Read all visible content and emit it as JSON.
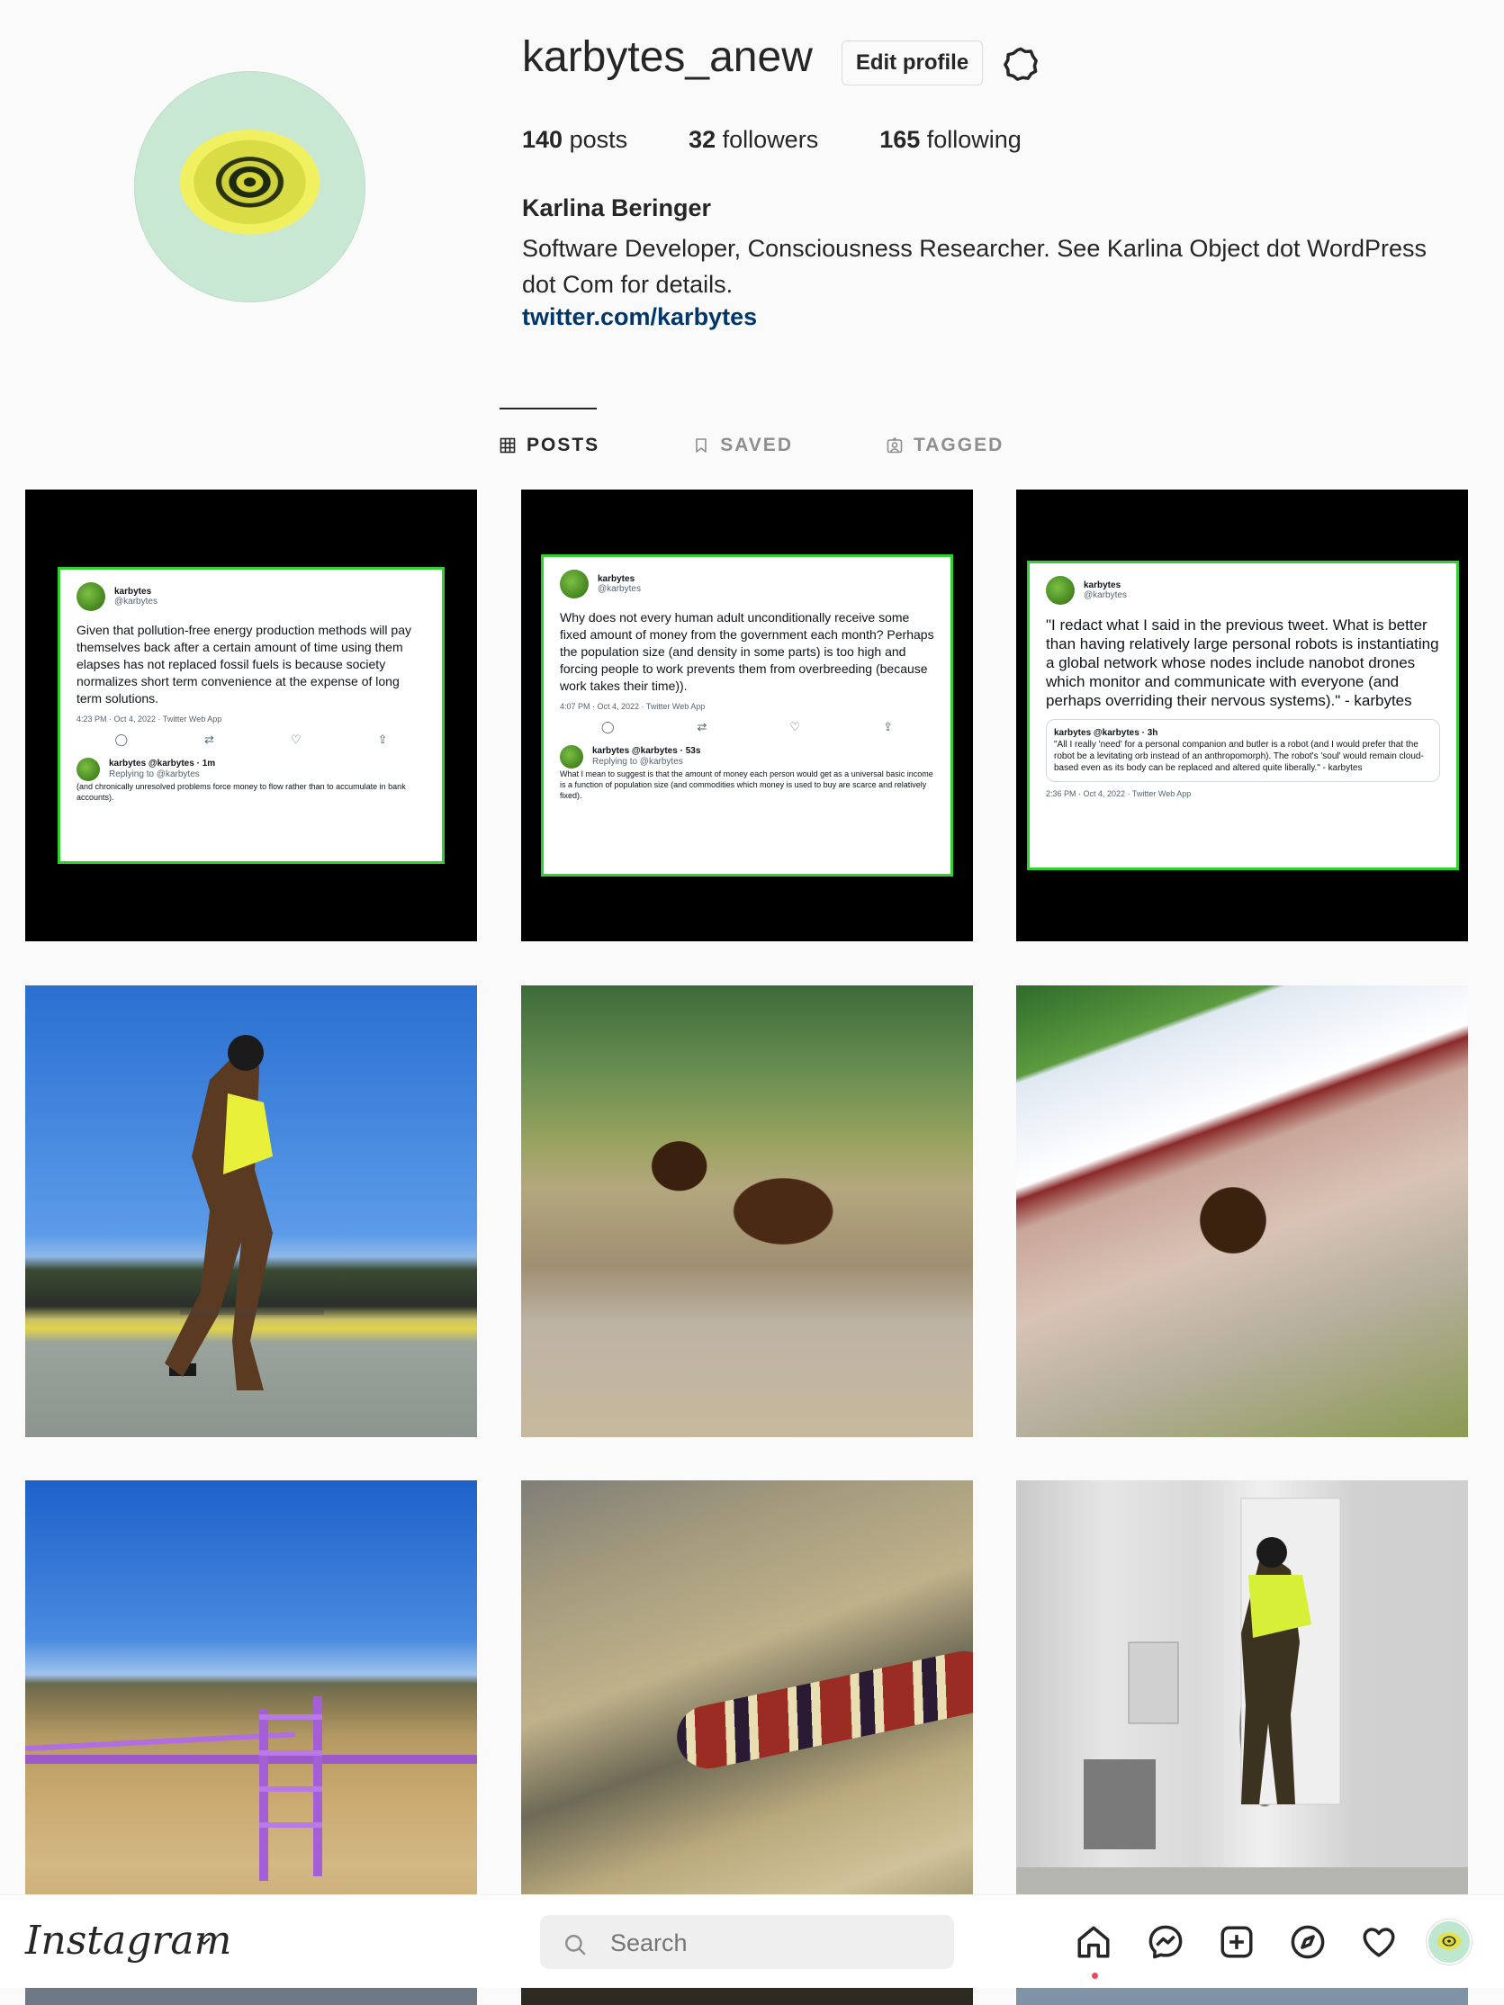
{
  "profile": {
    "username": "karbytes_anew",
    "edit_label": "Edit profile",
    "posts_count": "140",
    "posts_label": " posts",
    "followers_count": "32",
    "followers_label": " followers",
    "following_count": "165",
    "following_label": " following",
    "full_name": "Karlina Beringer",
    "bio": "Software Developer, Consciousness Researcher. See Karlina Object dot WordPress dot Com for details.",
    "link": "twitter.com/karbytes"
  },
  "tabs": [
    {
      "label": "POSTS",
      "active": true
    },
    {
      "label": "SAVED",
      "active": false
    },
    {
      "label": "TAGGED",
      "active": false
    }
  ],
  "tweets": [
    {
      "name": "karbytes",
      "handle": "@karbytes",
      "text": "Given that pollution-free energy production methods will pay themselves back after a certain amount of time using them elapses has not replaced fossil fuels is because society normalizes short term convenience at the expense of long term solutions.",
      "meta": "4:23 PM · Oct 4, 2022 · Twitter Web App",
      "reply_head": "karbytes @karbytes · 1m",
      "reply_to": "Replying to @karbytes",
      "reply_text": "(and chronically unresolved problems force money to flow rather than to accumulate in bank accounts)."
    },
    {
      "name": "karbytes",
      "handle": "@karbytes",
      "text": "Why does not every human adult unconditionally receive some fixed amount of money from the government each month? Perhaps the population size (and density in some parts) is too high and forcing people to work prevents them from overbreeding (because work takes their time)).",
      "meta": "4:07 PM · Oct 4, 2022 · Twitter Web App",
      "reply_head": "karbytes @karbytes · 53s",
      "reply_to": "Replying to @karbytes",
      "reply_text": "What I mean to suggest is that the amount of money each person would get as a universal basic income is a function of population size (and commodities which money is used to buy are scarce and relatively fixed)."
    },
    {
      "name": "karbytes",
      "handle": "@karbytes",
      "text": "\"I redact what I said in the previous tweet. What is better than having relatively large personal robots is instantiating a global network whose nodes include nanobot drones which monitor and communicate with everyone (and perhaps overriding their nervous systems).\" - karbytes",
      "quote_head": "karbytes @karbytes · 3h",
      "quote_text": "\"All I really 'need' for a personal companion and butler is a robot (and I would prefer that the robot be a levitating orb instead of an anthropomorph). The robot's 'soul' would remain cloud-based even as its body can be replaced and altered quite liberally.\" - karbytes",
      "meta": "2:36 PM · Oct 4, 2022 · Twitter Web App"
    }
  ],
  "nav": {
    "logo": "Instagram",
    "search_placeholder": "Search",
    "icons": [
      "home-icon",
      "messenger-icon",
      "new-post-icon",
      "explore-icon",
      "activity-heart-icon",
      "profile-avatar"
    ],
    "accent": "#ed4956",
    "link_color": "#00376b",
    "tweet_border": "#2fd12f"
  }
}
